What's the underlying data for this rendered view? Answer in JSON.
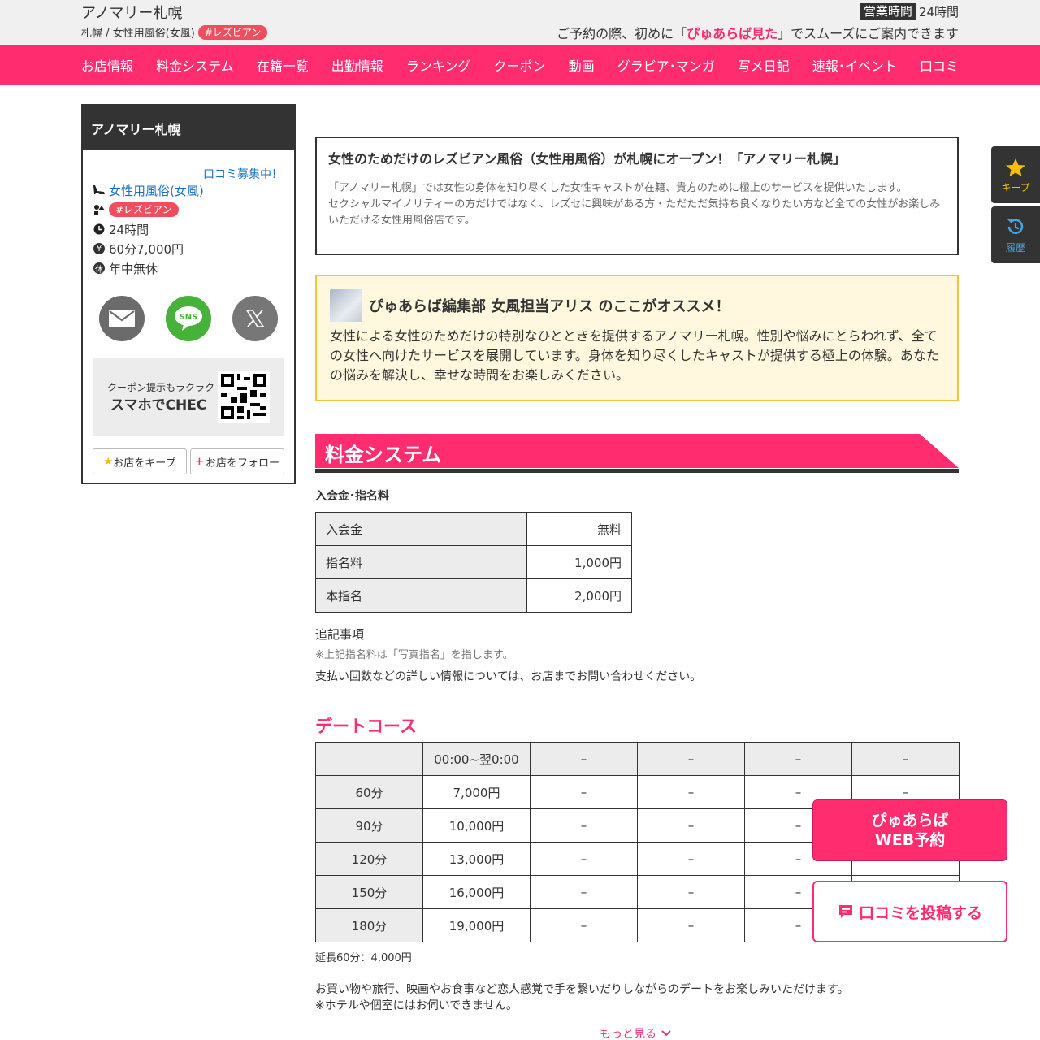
{
  "header": {
    "shop_name": "アノマリー札幌",
    "area": "札幌 / 女性用風俗(女風)",
    "tag": "#レズビアン",
    "hours_label": "営業時間",
    "hours_value": "24時間",
    "notice_pre": "ご予約の際、初めに「",
    "notice_em": "ぴゅあらば見た",
    "notice_post": "」でスムーズにご案内できます"
  },
  "nav": [
    "お店情報",
    "料金システム",
    "在籍一覧",
    "出勤情報",
    "ランキング",
    "クーポン",
    "動画",
    "グラビア･マンガ",
    "写メ日記",
    "速報･イベント",
    "口コミ"
  ],
  "sidebar": {
    "title": "アノマリー札幌",
    "review_link": "口コミ募集中！",
    "genre": "女性用風俗(女風)",
    "tag": "#レズビアン",
    "hours": "24時間",
    "price": "60分7,000円",
    "holiday": "年中無休",
    "holiday_icon": "休",
    "sns_label": "SNS",
    "coupon_small": "クーポン提示もラクラク",
    "coupon_big": "スマホでCHEC",
    "keep_button": "お店をキープ",
    "follow_button": "お店をフォロー"
  },
  "intro": {
    "title": "女性のためだけのレズビアン風俗（女性用風俗）が札幌にオープン！「アノマリー札幌」",
    "text1": "「アノマリー札幌」では女性の身体を知り尽くした女性キャストが在籍、貴方のために極上のサービスを提供いたします。",
    "text2": "セクシャルマイノリティーの方だけではなく、レズセに興味がある方・ただただ気持ち良くなりたい方など全ての女性がお楽しみいただける女性用風俗店です。"
  },
  "recommend": {
    "title": "ぴゅあらば編集部 女風担当アリス のここがオススメ！",
    "text": "女性による女性のためだけの特別なひとときを提供するアノマリー札幌。性別や悩みにとらわれず、全ての女性へ向けたサービスを展開しています。身体を知り尽くしたキャストが提供する極上の体験。あなたの悩みを解決し、幸せな時間をお楽しみください。"
  },
  "price_section": {
    "title": "料金システム",
    "sub_label": "入会金･指名料",
    "fees": [
      {
        "name": "入会金",
        "value": "無料"
      },
      {
        "name": "指名料",
        "value": "1,000円"
      },
      {
        "name": "本指名",
        "value": "2,000円"
      }
    ],
    "note_title": "追記事項",
    "note_sub": "※上記指名料は「写真指名」を指します。",
    "note_text": "支払い回数などの詳しい情報については、お店までお問い合わせください。"
  },
  "date_course": {
    "title": "デートコース",
    "header": [
      "",
      "00:00~翌0:00",
      "–",
      "–",
      "–",
      "–"
    ],
    "rows": [
      [
        "60分",
        "7,000円",
        "–",
        "–",
        "–",
        "–"
      ],
      [
        "90分",
        "10,000円",
        "–",
        "–",
        "–",
        "–"
      ],
      [
        "120分",
        "13,000円",
        "–",
        "–",
        "–",
        "–"
      ],
      [
        "150分",
        "16,000円",
        "–",
        "–",
        "–",
        "–"
      ],
      [
        "180分",
        "19,000円",
        "–",
        "–",
        "–",
        "–"
      ]
    ],
    "extension": "延長60分：4,000円",
    "desc1": "お買い物や旅行、映画やお食事など恋人感覚で手を繋いだりしながらのデートをお楽しみいただけます。",
    "desc2": "※ホテルや個室にはお伺いできません。",
    "more": "もっと見る"
  },
  "floating": {
    "keep": "キープ",
    "history": "履歴",
    "web_line1": "ぴゅあらば",
    "web_line2": "WEB予約",
    "review": "口コミを投稿する"
  },
  "colors": {
    "accent": "#ff2d6f",
    "dark": "#333333",
    "tag": "#f04e5e",
    "link": "#1a6fc2",
    "highlight_bg": "#fff8de",
    "highlight_border": "#f5c33b"
  }
}
